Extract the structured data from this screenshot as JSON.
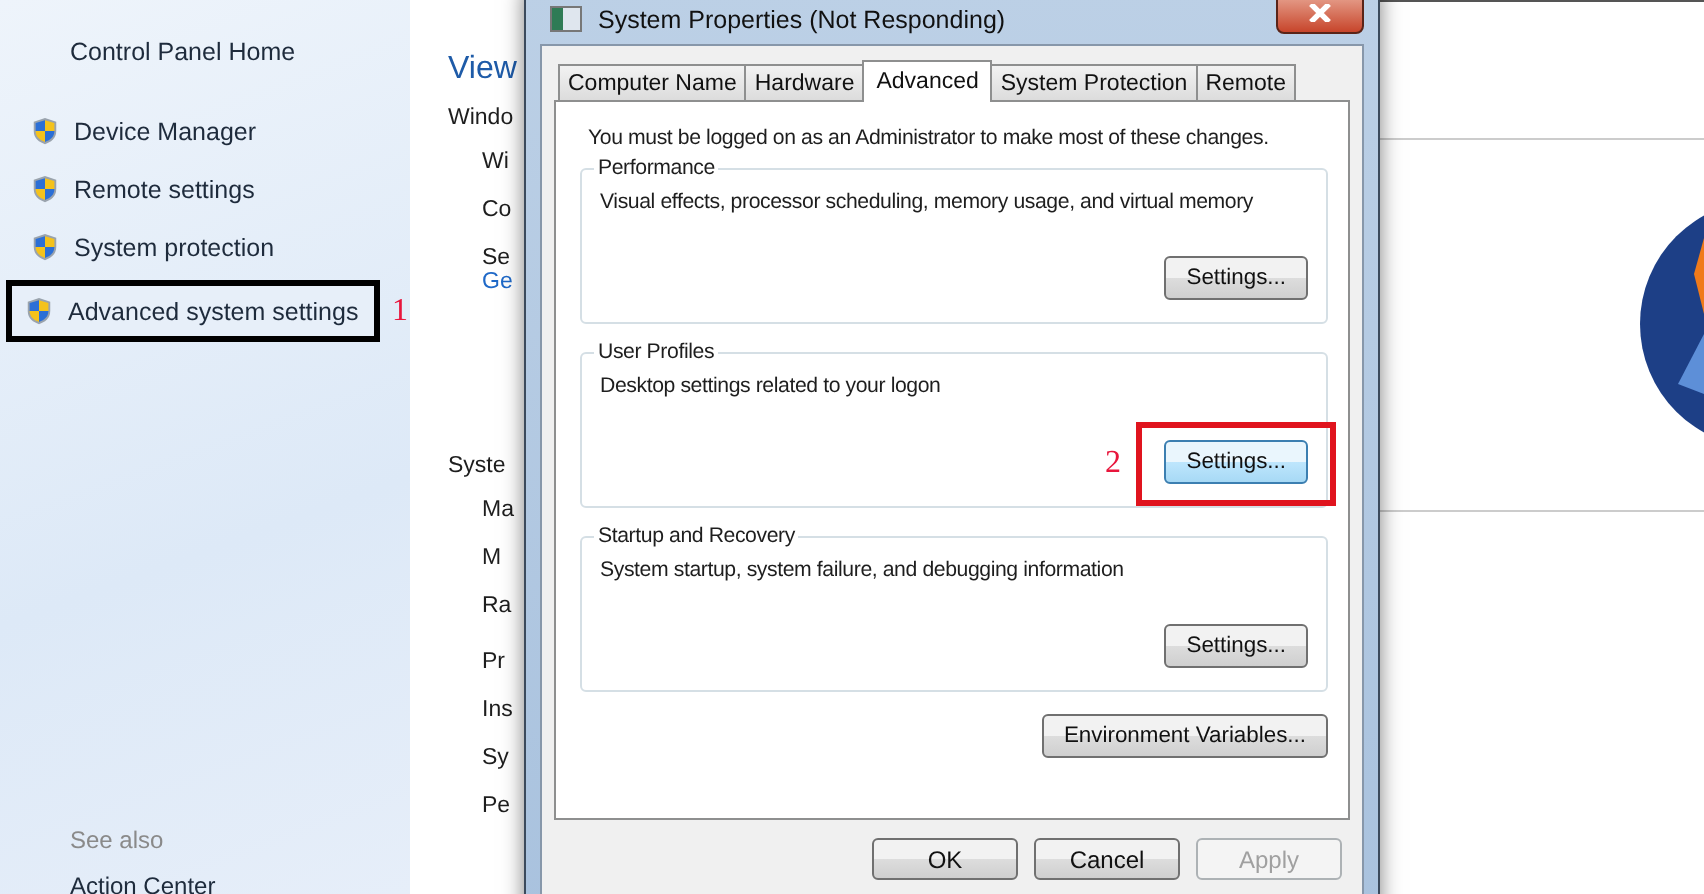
{
  "sidebar": {
    "home_link": "Control Panel Home",
    "items": [
      {
        "label": "Device Manager"
      },
      {
        "label": "Remote settings"
      },
      {
        "label": "System protection"
      },
      {
        "label": "Advanced system settings",
        "annotation": "1"
      }
    ],
    "see_also": {
      "heading": "See also",
      "links": [
        "Action Center"
      ]
    }
  },
  "main_content": {
    "title": "View",
    "sections": [
      {
        "heading": "Windo",
        "groups": [
          [
            {
              "text": "Wi",
              "kind": "item"
            },
            {
              "text": "Co",
              "kind": "item"
            },
            {
              "text": "Se",
              "kind": "item"
            },
            {
              "text": "Ge",
              "kind": "link"
            }
          ]
        ]
      },
      {
        "heading": "Syste",
        "groups": [
          [
            {
              "text": "Ma",
              "kind": "item"
            },
            {
              "text": "M",
              "kind": "item"
            },
            {
              "text": "Ra",
              "kind": "item"
            }
          ],
          [
            {
              "text": "Pr",
              "kind": "item"
            },
            {
              "text": "Ins",
              "kind": "item"
            },
            {
              "text": "Sy",
              "kind": "item"
            },
            {
              "text": "Pe",
              "kind": "item"
            }
          ]
        ]
      }
    ]
  },
  "dialog": {
    "title": "System Properties (Not Responding)",
    "tabs": [
      {
        "label": "Computer Name",
        "selected": false
      },
      {
        "label": "Hardware",
        "selected": false
      },
      {
        "label": "Advanced",
        "selected": true
      },
      {
        "label": "System Protection",
        "selected": false
      },
      {
        "label": "Remote",
        "selected": false
      }
    ],
    "notice": "You must be logged on as an Administrator to make most of these changes.",
    "groups": [
      {
        "title": "Performance",
        "description": "Visual effects, processor scheduling, memory usage, and virtual memory",
        "button": "Settings..."
      },
      {
        "title": "User Profiles",
        "description": "Desktop settings related to your logon",
        "button": "Settings...",
        "annotation": "2"
      },
      {
        "title": "Startup and Recovery",
        "description": "System startup, system failure, and debugging information",
        "button": "Settings..."
      }
    ],
    "env_button": "Environment Variables...",
    "buttons": [
      {
        "label": "OK",
        "disabled": false
      },
      {
        "label": "Cancel",
        "disabled": false
      },
      {
        "label": "Apply",
        "disabled": true
      }
    ]
  }
}
